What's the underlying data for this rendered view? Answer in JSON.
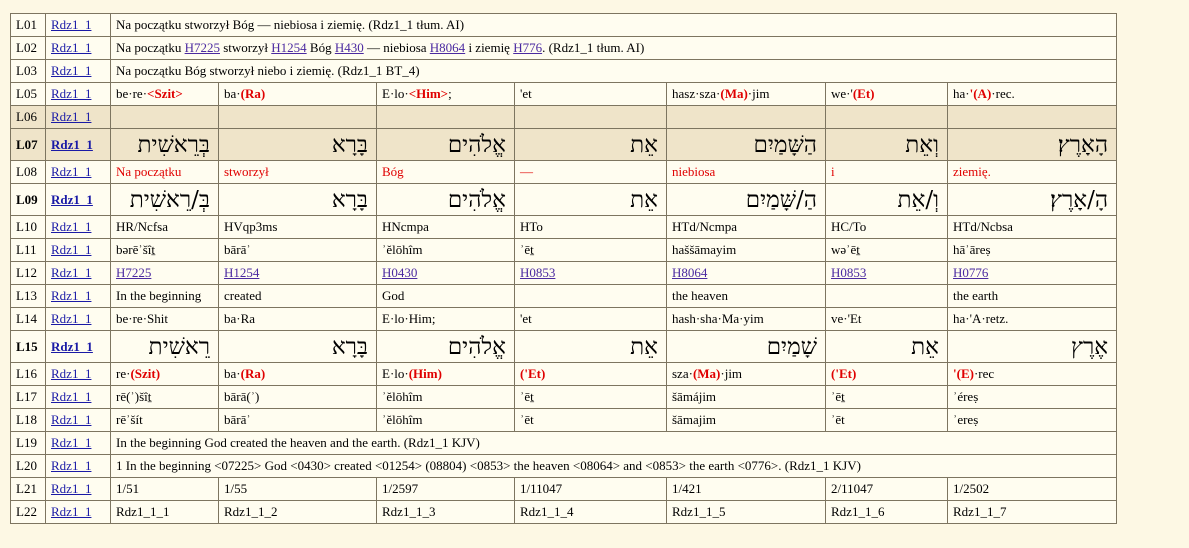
{
  "ref": "Rdz1_1",
  "rows": {
    "L01": {
      "id": "L01",
      "text": "Na początku stworzył Bóg — niebiosa i ziemię. (Rdz1_1 tłum. AI)"
    },
    "L02": {
      "id": "L02",
      "parts": [
        "Na początku ",
        "H7225",
        " stworzył ",
        "H1254",
        " Bóg ",
        "H430",
        " — niebiosa ",
        "H8064",
        " i ziemię ",
        "H776",
        ". (Rdz1_1 tłum. AI)"
      ]
    },
    "L03": {
      "id": "L03",
      "text": "Na początku Bóg stworzył niebo i ziemię. (Rdz1_1 BT_4)"
    },
    "L05": {
      "id": "L05",
      "cells": [
        [
          "be·re·",
          "<Szit>",
          ""
        ],
        [
          "ba·",
          "(Ra)",
          ""
        ],
        [
          "E·lo·",
          "<Him>",
          ";"
        ],
        [
          "'et",
          "",
          ""
        ],
        [
          "hasz·sza·",
          "(Ma)",
          "·jim"
        ],
        [
          "we·'",
          "(Et)",
          ""
        ],
        [
          "ha·",
          "'(A)",
          "·rec."
        ]
      ]
    },
    "L06": {
      "id": "L06"
    },
    "L07": {
      "id": "L07",
      "cells": [
        "בְּרֵאשִׁית",
        "בָּרָא",
        "אֱלֹהִים",
        "אֵת",
        "הַשָּׁמַיִם",
        "וְאֵת",
        "הָאָרֶץ׃"
      ]
    },
    "L08": {
      "id": "L08",
      "cells": [
        "Na początku",
        "stworzył",
        "Bóg",
        "—",
        "niebiosa",
        "i",
        "ziemię."
      ]
    },
    "L09": {
      "id": "L09",
      "cells": [
        "בְּ/רֵאשִׁית",
        "בָּרָא",
        "אֱלֹהִים",
        "אֵת",
        "הַ/שָּׁמַיִם",
        "וְ/אֵת",
        "הָ/אָרֶץ׃"
      ]
    },
    "L10": {
      "id": "L10",
      "cells": [
        "HR/Ncfsa",
        "HVqp3ms",
        "HNcmpa",
        "HTo",
        "HTd/Ncmpa",
        "HC/To",
        "HTd/Ncbsa"
      ]
    },
    "L11": {
      "id": "L11",
      "cells": [
        "bərēʾšîṯ",
        "bārāʾ",
        "ʾĕlōhîm",
        "ʾēṯ",
        "haššāmayim",
        "wəʾēṯ",
        "hāʾāreṣ"
      ]
    },
    "L12": {
      "id": "L12",
      "cells": [
        "H7225",
        "H1254",
        "H0430",
        "H0853",
        "H8064",
        "H0853",
        "H0776"
      ]
    },
    "L13": {
      "id": "L13",
      "cells": [
        "In the beginning",
        "created",
        "God",
        "",
        "the heaven",
        "",
        "the earth"
      ]
    },
    "L14": {
      "id": "L14",
      "cells": [
        "be·re·Shit",
        "ba·Ra",
        "E·lo·Him;",
        "'et",
        "hash·sha·Ma·yim",
        "ve·'Et",
        "ha·'A·retz."
      ]
    },
    "L15": {
      "id": "L15",
      "cells": [
        "רֵאשִׁית",
        "בָּרָא",
        "אֱלֹהִים",
        "אֵת",
        "שָׁמַיִם",
        "אֵת",
        "אֶרֶץ"
      ]
    },
    "L16": {
      "id": "L16",
      "cells": [
        [
          "re·",
          "(Szit)",
          ""
        ],
        [
          "ba·",
          "(Ra)",
          ""
        ],
        [
          "E·lo·",
          "(Him)",
          ""
        ],
        [
          "",
          "('Et)",
          ""
        ],
        [
          "sza·",
          "(Ma)",
          "·jim"
        ],
        [
          "",
          "('Et)",
          ""
        ],
        [
          "",
          "'(E)",
          "·rec"
        ]
      ]
    },
    "L17": {
      "id": "L17",
      "cells": [
        "rē(ʾ)šîṯ",
        "bārā(ʾ)",
        "ʾĕlōhîm",
        "ʾēṯ",
        "šāmájim",
        "ʾēṯ",
        "ʾéreṣ"
      ]
    },
    "L18": {
      "id": "L18",
      "cells": [
        "rēʾšít",
        "bārāʾ",
        "ʾĕlōhîm",
        "ʾēt",
        "šāmajim",
        "ʾēt",
        "ʾereṣ"
      ]
    },
    "L19": {
      "id": "L19",
      "text": "In the beginning God created the heaven and the earth. (Rdz1_1 KJV)"
    },
    "L20": {
      "id": "L20",
      "text": "1 In the beginning <07225> God <0430> created <01254> (08804) <0853> the heaven <08064> and <0853> the earth <0776>. (Rdz1_1 KJV)"
    },
    "L21": {
      "id": "L21",
      "cells": [
        "1/51",
        "1/55",
        "1/2597",
        "1/11047",
        "1/421",
        "2/11047",
        "1/2502"
      ]
    },
    "L22": {
      "id": "L22",
      "cells": [
        "Rdz1_1_1",
        "Rdz1_1_2",
        "Rdz1_1_3",
        "Rdz1_1_4",
        "Rdz1_1_5",
        "Rdz1_1_6",
        "Rdz1_1_7"
      ]
    }
  },
  "colors": {
    "background": "#fdf8e4",
    "highlight_row": "#efe4c9",
    "link": "#1a1aa6",
    "strong_link": "#4b2aa0",
    "emphasis": "#e00000"
  }
}
